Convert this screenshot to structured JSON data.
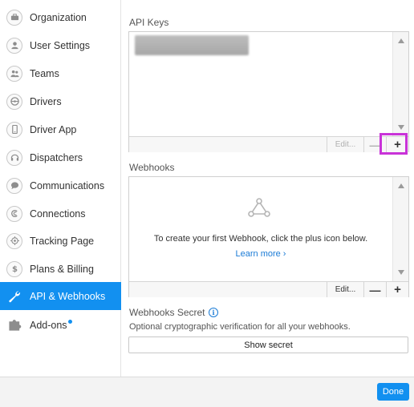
{
  "sidebar": {
    "items": [
      {
        "label": "Organization",
        "icon": "briefcase-icon"
      },
      {
        "label": "User Settings",
        "icon": "user-icon"
      },
      {
        "label": "Teams",
        "icon": "team-icon"
      },
      {
        "label": "Drivers",
        "icon": "steering-wheel-icon"
      },
      {
        "label": "Driver App",
        "icon": "phone-icon"
      },
      {
        "label": "Dispatchers",
        "icon": "headset-icon"
      },
      {
        "label": "Communications",
        "icon": "chat-bubble-icon"
      },
      {
        "label": "Connections",
        "icon": "connection-icon"
      },
      {
        "label": "Tracking Page",
        "icon": "target-icon"
      },
      {
        "label": "Plans & Billing",
        "icon": "dollar-icon"
      },
      {
        "label": "API & Webhooks",
        "icon": "wrench-icon",
        "active": true
      },
      {
        "label": "Add-ons",
        "icon": "puzzle-icon",
        "new_dot": true
      }
    ],
    "active_color": "#1290f0"
  },
  "api_keys": {
    "title": "API Keys",
    "edit_label": "Edit...",
    "remove_label": "—",
    "add_label": "+"
  },
  "webhooks": {
    "title": "Webhooks",
    "empty_message": "To create your first Webhook, click the plus icon below.",
    "learn_more": "Learn more ›",
    "edit_label": "Edit...",
    "remove_label": "—",
    "add_label": "+"
  },
  "secret": {
    "title": "Webhooks Secret",
    "info": "i",
    "description": "Optional cryptographic verification for all your webhooks.",
    "button_label": "Show secret"
  },
  "footer": {
    "done_label": "Done"
  },
  "colors": {
    "accent": "#1290f0",
    "highlight": "#c933d8",
    "link": "#1a7bd6"
  }
}
